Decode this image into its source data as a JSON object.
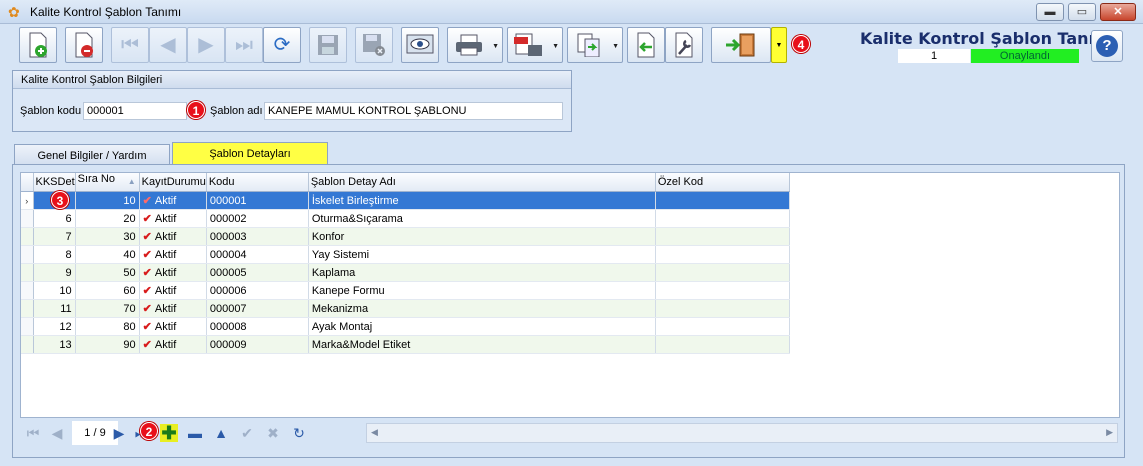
{
  "window": {
    "title": "Kalite Kontrol Şablon Tanımı",
    "buttons": {
      "minimize": "▬",
      "maximize": "▭",
      "close": "✕"
    }
  },
  "toolbar": {
    "icons": [
      "new-document-icon",
      "delete-document-icon",
      "first-record-icon",
      "previous-record-icon",
      "next-record-icon",
      "last-record-icon",
      "refresh-icon",
      "save-icon",
      "cancel-save-icon",
      "preview-icon",
      "print-icon",
      "pdf-export-icon",
      "export-icon",
      "import-icon",
      "tools-icon",
      "exit-icon"
    ]
  },
  "header": {
    "form_title": "Kalite Kontrol Şablon Tanımı",
    "record_number": "1",
    "status": "Onaylandı",
    "status_color": "#22ee22",
    "help_label": "?"
  },
  "markers": [
    "1",
    "2",
    "3",
    "4"
  ],
  "info_group": {
    "title": "Kalite Kontrol Şablon Bilgileri",
    "code_label": "Şablon kodu",
    "code_value": "000001",
    "name_label": "Şablon adı",
    "name_value": "KANEPE MAMUL KONTROL ŞABLONU"
  },
  "tabs": [
    {
      "label": "Genel Bilgiler / Yardım",
      "active": false
    },
    {
      "label": "Şablon Detayları",
      "active": true
    }
  ],
  "grid": {
    "columns": [
      "KKSDet",
      "Sıra No",
      "KayıtDurumu",
      "Kodu",
      "Şablon Detay Adı",
      "Özel Kod"
    ],
    "rows": [
      {
        "id": "",
        "sira": "10",
        "durum": "Aktif",
        "kodu": "000001",
        "ad": "İskelet Birleştirme",
        "ozel": ""
      },
      {
        "id": "6",
        "sira": "20",
        "durum": "Aktif",
        "kodu": "000002",
        "ad": "Oturma&Sıçarama",
        "ozel": ""
      },
      {
        "id": "7",
        "sira": "30",
        "durum": "Aktif",
        "kodu": "000003",
        "ad": "Konfor",
        "ozel": ""
      },
      {
        "id": "8",
        "sira": "40",
        "durum": "Aktif",
        "kodu": "000004",
        "ad": "Yay Sistemi",
        "ozel": ""
      },
      {
        "id": "9",
        "sira": "50",
        "durum": "Aktif",
        "kodu": "000005",
        "ad": "Kaplama",
        "ozel": ""
      },
      {
        "id": "10",
        "sira": "60",
        "durum": "Aktif",
        "kodu": "000006",
        "ad": "Kanepe Formu",
        "ozel": ""
      },
      {
        "id": "11",
        "sira": "70",
        "durum": "Aktif",
        "kodu": "000007",
        "ad": "Mekanizma",
        "ozel": ""
      },
      {
        "id": "12",
        "sira": "80",
        "durum": "Aktif",
        "kodu": "000008",
        "ad": "Ayak Montaj",
        "ozel": ""
      },
      {
        "id": "13",
        "sira": "90",
        "durum": "Aktif",
        "kodu": "000009",
        "ad": "Marka&Model Etiket",
        "ozel": ""
      }
    ]
  },
  "navigator": {
    "position": "1 / 9"
  }
}
